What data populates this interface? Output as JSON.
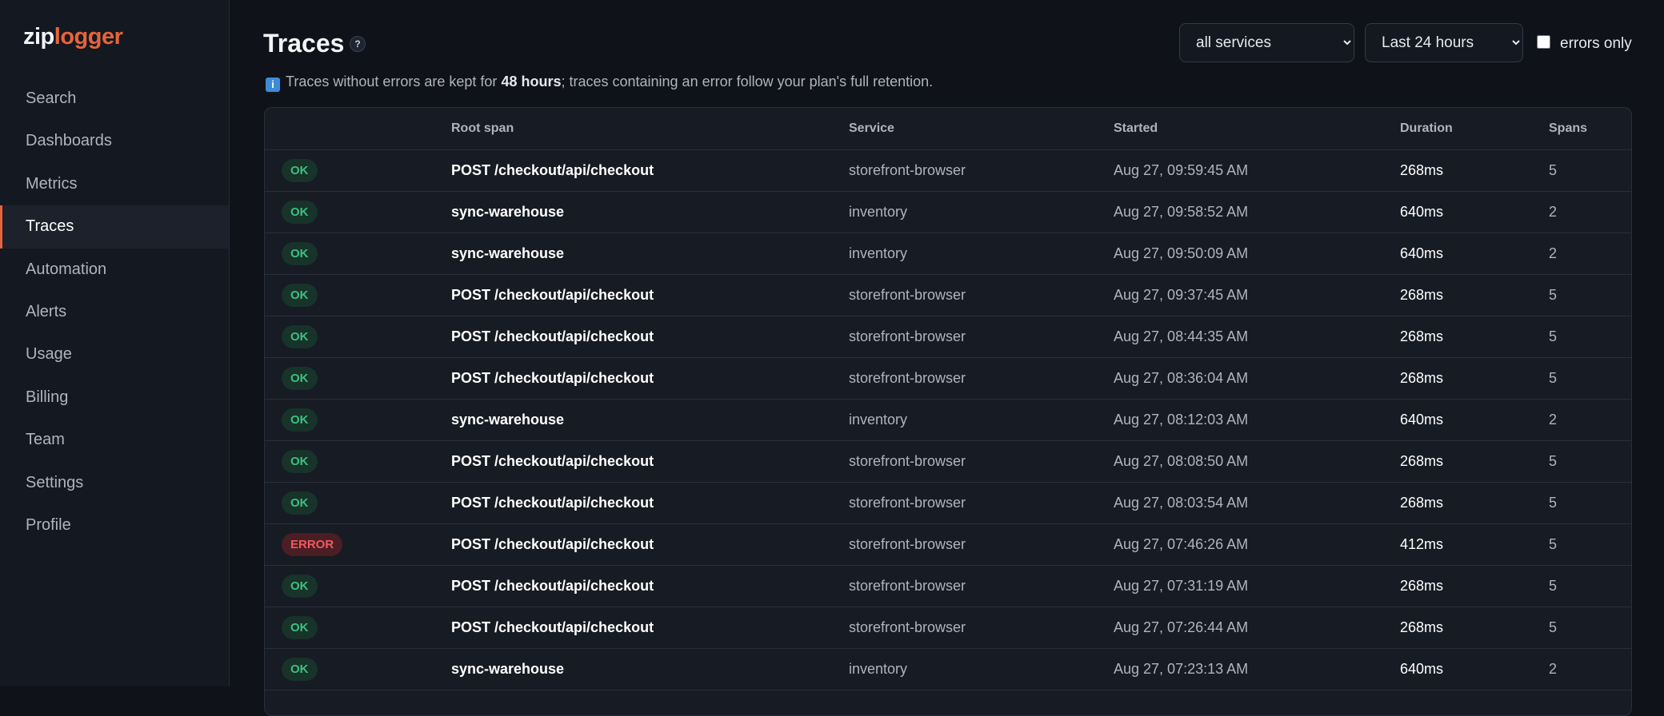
{
  "sidebar": {
    "logo_part1": "zip",
    "logo_part2": "logger",
    "items": [
      {
        "label": "Search"
      },
      {
        "label": "Dashboards"
      },
      {
        "label": "Metrics"
      },
      {
        "label": "Traces",
        "active": true
      },
      {
        "label": "Automation"
      },
      {
        "label": "Alerts"
      },
      {
        "label": "Usage"
      },
      {
        "label": "Billing"
      },
      {
        "label": "Team"
      },
      {
        "label": "Settings"
      },
      {
        "label": "Profile"
      }
    ]
  },
  "header": {
    "title": "Traces",
    "help": "?"
  },
  "info": {
    "icon": "i",
    "text1": "Traces without errors are kept for ",
    "bold": "48 hours",
    "text2": "; traces containing an error follow your plan's full retention."
  },
  "filters": {
    "service": "all services",
    "time_range": "Last 24 hours",
    "errors_only_label": "errors only"
  },
  "table": {
    "columns": [
      "",
      "Root span",
      "Service",
      "Started",
      "Duration",
      "Spans"
    ],
    "rows": [
      {
        "status": "OK",
        "span": "POST /checkout/api/checkout",
        "service": "storefront-browser",
        "started": "Aug 27, 09:59:45 AM",
        "duration": "268ms",
        "spans": "5"
      },
      {
        "status": "OK",
        "span": "sync-warehouse",
        "service": "inventory",
        "started": "Aug 27, 09:58:52 AM",
        "duration": "640ms",
        "spans": "2"
      },
      {
        "status": "OK",
        "span": "sync-warehouse",
        "service": "inventory",
        "started": "Aug 27, 09:50:09 AM",
        "duration": "640ms",
        "spans": "2"
      },
      {
        "status": "OK",
        "span": "POST /checkout/api/checkout",
        "service": "storefront-browser",
        "started": "Aug 27, 09:37:45 AM",
        "duration": "268ms",
        "spans": "5"
      },
      {
        "status": "OK",
        "span": "POST /checkout/api/checkout",
        "service": "storefront-browser",
        "started": "Aug 27, 08:44:35 AM",
        "duration": "268ms",
        "spans": "5"
      },
      {
        "status": "OK",
        "span": "POST /checkout/api/checkout",
        "service": "storefront-browser",
        "started": "Aug 27, 08:36:04 AM",
        "duration": "268ms",
        "spans": "5"
      },
      {
        "status": "OK",
        "span": "sync-warehouse",
        "service": "inventory",
        "started": "Aug 27, 08:12:03 AM",
        "duration": "640ms",
        "spans": "2"
      },
      {
        "status": "OK",
        "span": "POST /checkout/api/checkout",
        "service": "storefront-browser",
        "started": "Aug 27, 08:08:50 AM",
        "duration": "268ms",
        "spans": "5"
      },
      {
        "status": "OK",
        "span": "POST /checkout/api/checkout",
        "service": "storefront-browser",
        "started": "Aug 27, 08:03:54 AM",
        "duration": "268ms",
        "spans": "5"
      },
      {
        "status": "ERROR",
        "span": "POST /checkout/api/checkout",
        "service": "storefront-browser",
        "started": "Aug 27, 07:46:26 AM",
        "duration": "412ms",
        "spans": "5"
      },
      {
        "status": "OK",
        "span": "POST /checkout/api/checkout",
        "service": "storefront-browser",
        "started": "Aug 27, 07:31:19 AM",
        "duration": "268ms",
        "spans": "5"
      },
      {
        "status": "OK",
        "span": "POST /checkout/api/checkout",
        "service": "storefront-browser",
        "started": "Aug 27, 07:26:44 AM",
        "duration": "268ms",
        "spans": "5"
      },
      {
        "status": "OK",
        "span": "sync-warehouse",
        "service": "inventory",
        "started": "Aug 27, 07:23:13 AM",
        "duration": "640ms",
        "spans": "2"
      }
    ]
  }
}
